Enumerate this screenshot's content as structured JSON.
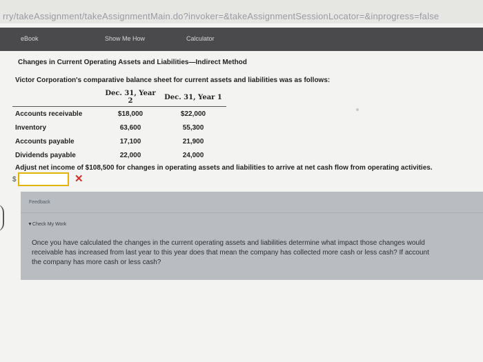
{
  "browser": {
    "url": "rry/takeAssignment/takeAssignmentMain.do?invoker=&takeAssignmentSessionLocator=&inprogress=false"
  },
  "toolbar": {
    "tabs": [
      "eBook",
      "Show Me How",
      "Calculator"
    ]
  },
  "problem": {
    "heading": "Changes in Current Operating Assets and Liabilities—Indirect Method",
    "intro": "Victor Corporation's comparative balance sheet for current assets and liabilities was as follows:",
    "table": {
      "headers": [
        "",
        "Dec. 31, Year 2",
        "Dec. 31, Year 1"
      ],
      "rows": [
        {
          "label": "Accounts receivable",
          "year2": "$18,000",
          "year1": "$22,000"
        },
        {
          "label": "Inventory",
          "year2": "63,600",
          "year1": "55,300"
        },
        {
          "label": "Accounts payable",
          "year2": "17,100",
          "year1": "21,900"
        },
        {
          "label": "Dividends payable",
          "year2": "22,000",
          "year1": "24,000"
        }
      ]
    },
    "question": "Adjust net income of $108,500 for changes in operating assets and liabilities to arrive at net cash flow from operating activities.",
    "answer": {
      "currency": "$",
      "value": "",
      "status_icon": "✕"
    }
  },
  "feedback": {
    "title": "Feedback",
    "check_label": "▼Check My Work",
    "lines": [
      "Once you have calculated the changes in the current operating assets and liabilities determine what impact those changes would",
      "receivable has increased from last year to this year does that mean the company has collected more cash or less cash? If account",
      "the company has more cash or less cash?"
    ]
  }
}
